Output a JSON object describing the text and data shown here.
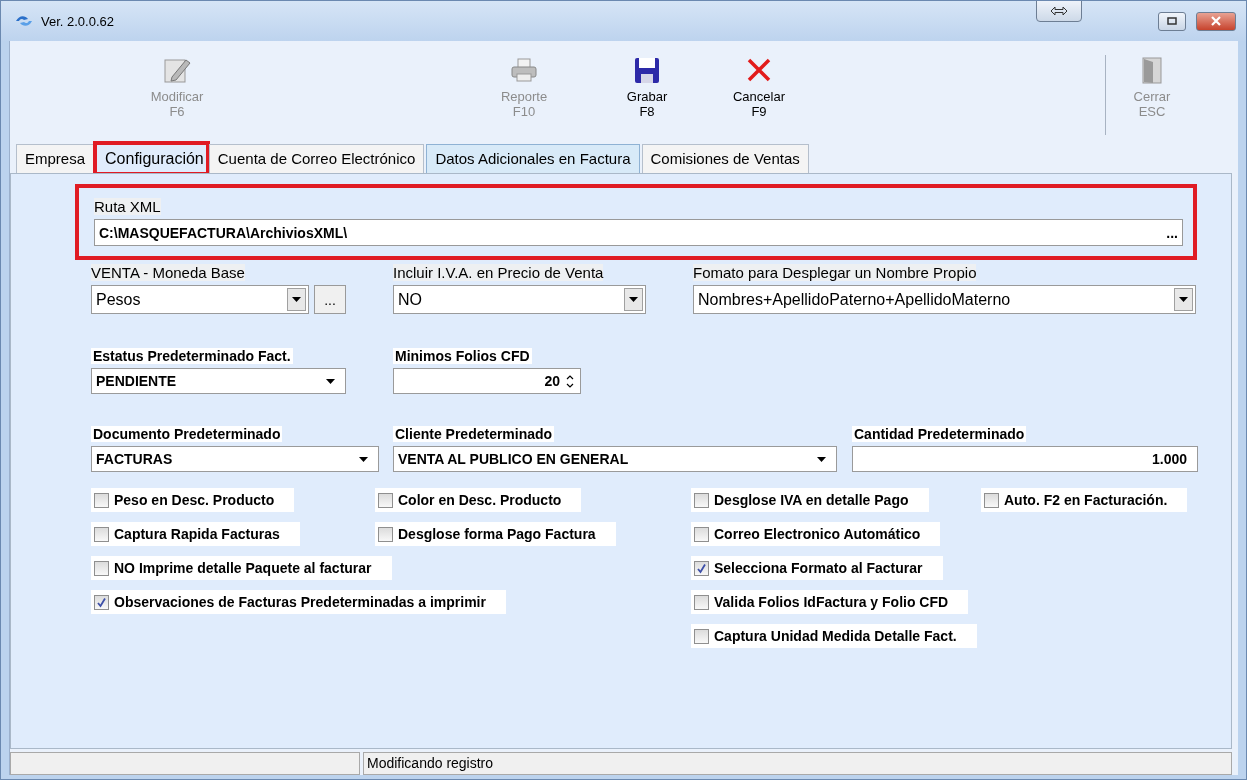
{
  "window": {
    "title": "Ver. 2.0.0.62"
  },
  "toolbar": [
    {
      "label": "Modificar",
      "key": "F6",
      "kind": "edit",
      "disabled": true
    },
    {
      "label": "Reporte",
      "key": "F10",
      "kind": "print",
      "disabled": true
    },
    {
      "label": "Grabar",
      "key": "F8",
      "kind": "save",
      "disabled": false
    },
    {
      "label": "Cancelar",
      "key": "F9",
      "kind": "cancel",
      "disabled": false
    },
    {
      "label": "Cerrar",
      "key": "ESC",
      "kind": "exit",
      "disabled": true
    }
  ],
  "tabs": [
    {
      "label": "Empresa",
      "selected": false,
      "hovered": false,
      "highlighted": false
    },
    {
      "label": "Configuración",
      "selected": true,
      "hovered": false,
      "highlighted": true
    },
    {
      "label": "Cuenta de Correo Electrónico",
      "selected": false,
      "hovered": false,
      "highlighted": false
    },
    {
      "label": "Datos Adicionales en Factura",
      "selected": false,
      "hovered": true,
      "highlighted": false
    },
    {
      "label": "Comisiones de Ventas",
      "selected": false,
      "hovered": false,
      "highlighted": false
    }
  ],
  "ruta_xml": {
    "label": "Ruta XML",
    "value": "C:\\MASQUEFACTURA\\ArchiviosXML\\",
    "button": "...",
    "highlighted": true
  },
  "field_rows": [
    [
      {
        "kind": "select",
        "label": "VENTA - Moneda Base",
        "value": "Pesos",
        "extra_button": "..."
      },
      {
        "kind": "select",
        "label": "Incluir I.V.A. en Precio de Venta",
        "value": "NO"
      },
      {
        "kind": "select",
        "label": "Fomato para Desplegar un Nombre Propio",
        "value": "Nombres+ApellidoPaterno+ApellidoMaterno"
      }
    ],
    [
      {
        "kind": "dropdown",
        "label": "Estatus Predeterminado Fact.",
        "value": "PENDIENTE"
      },
      {
        "kind": "spin",
        "label": "Minimos Folios CFD",
        "value": "20"
      }
    ],
    [
      {
        "kind": "dropdown",
        "label": "Documento Predeterminado",
        "value": "FACTURAS"
      },
      {
        "kind": "dropdown",
        "label": "Cliente Predeterminado",
        "value": "VENTA AL PUBLICO EN GENERAL"
      },
      {
        "kind": "number",
        "label": "Cantidad  Predeterminado",
        "value": "1.000"
      }
    ]
  ],
  "option_columns": [
    [
      {
        "label": "Peso en Desc. Producto",
        "checked": false
      },
      {
        "label": "Captura Rapida Facturas",
        "checked": false
      },
      {
        "label": "NO Imprime detalle Paquete al facturar",
        "checked": false
      },
      {
        "label": "Observaciones de Facturas Predeterminadas a imprimir",
        "checked": true
      }
    ],
    [
      {
        "label": "Color en Desc. Producto",
        "checked": false
      },
      {
        "label": "Desglose forma Pago Factura",
        "checked": false
      }
    ],
    [
      {
        "label": "Desglose IVA en detalle Pago",
        "checked": false
      },
      {
        "label": "Correo Electronico Automático",
        "checked": false
      },
      {
        "label": "Selecciona Formato al Facturar",
        "checked": true
      },
      {
        "label": "Valida Folios IdFactura y Folio CFD",
        "checked": false
      },
      {
        "label": "Captura Unidad Medida Detalle Fact.",
        "checked": false
      }
    ],
    [
      {
        "label": "Auto. F2 en Facturación.",
        "checked": false
      }
    ]
  ],
  "status_bar": {
    "message": "Modificando registro"
  }
}
